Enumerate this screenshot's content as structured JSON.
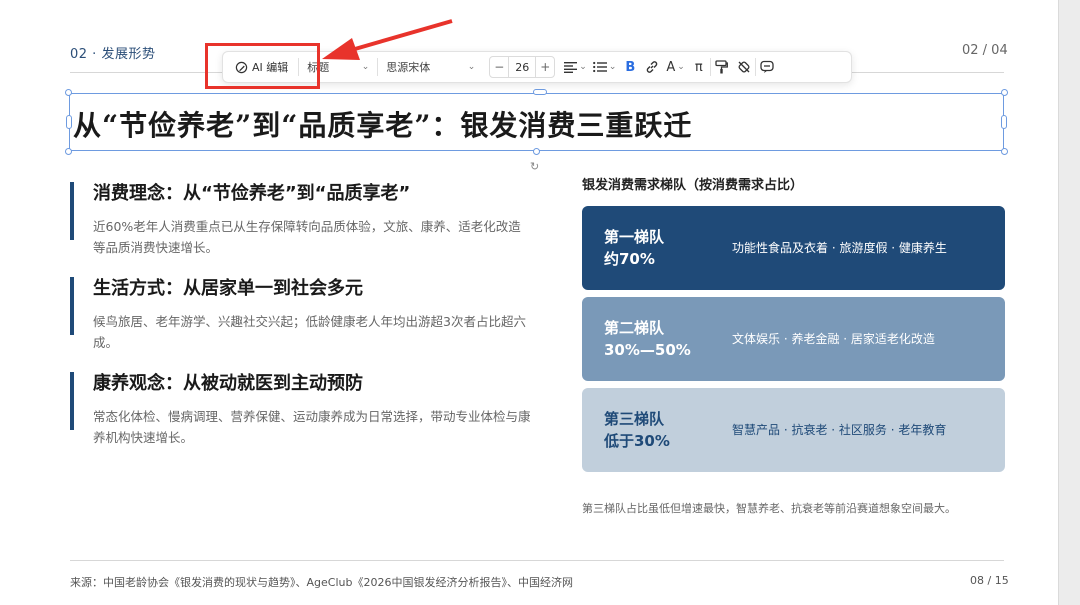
{
  "header": {
    "section_label": "02 · 发展形势",
    "page_indicator": "02 / 04"
  },
  "toolbar": {
    "ai_edit_label": "AI 编辑",
    "style_select": "标题",
    "font_select": "思源宋体",
    "font_size": "26",
    "decrease_label": "−",
    "increase_label": "+"
  },
  "title": "从“节俭养老”到“品质享老”：银发消费三重跃迁",
  "points": [
    {
      "title": "消费理念：从“节俭养老”到“品质享老”",
      "desc": "近60%老年人消费重点已从生存保障转向品质体验，文旅、康养、适老化改造等品质消费快速增长。"
    },
    {
      "title": "生活方式：从居家单一到社会多元",
      "desc": "候鸟旅居、老年游学、兴趣社交兴起；低龄健康老人年均出游超3次者占比超六成。"
    },
    {
      "title": "康养观念：从被动就医到主动预防",
      "desc": "常态化体检、慢病调理、营养保健、运动康养成为日常选择，带动专业体检与康养机构快速增长。"
    }
  ],
  "tiers": {
    "heading": "银发消费需求梯队（按消费需求占比）",
    "items": [
      {
        "name": "第一梯队",
        "share": "约70%",
        "items": "功能性食品及衣着 · 旅游度假 · 健康养生",
        "bg": "#1f4a78",
        "fg": "#ffffff"
      },
      {
        "name": "第二梯队",
        "share": "30%—50%",
        "items": "文体娱乐 · 养老金融 · 居家适老化改造",
        "bg": "#7a99b8",
        "fg": "#ffffff"
      },
      {
        "name": "第三梯队",
        "share": "低于30%",
        "items": "智慧产品 · 抗衰老 · 社区服务 · 老年教育",
        "bg": "#c1cfdc",
        "fg": "#1f4a78"
      }
    ],
    "note": "第三梯队占比虽低但增速最快，智慧养老、抗衰老等前沿赛道想象空间最大。"
  },
  "footer": {
    "source": "来源：中国老龄协会《银发消费的现状与趋势》、AgeClub《2026中国银发经济分析报告》、中国经济网",
    "page": "08 / 15"
  },
  "colors": {
    "accent": "#1f4a78",
    "selection": "#6e9be0",
    "annotation": "#e8332b",
    "active_tool": "#2a6de0"
  }
}
